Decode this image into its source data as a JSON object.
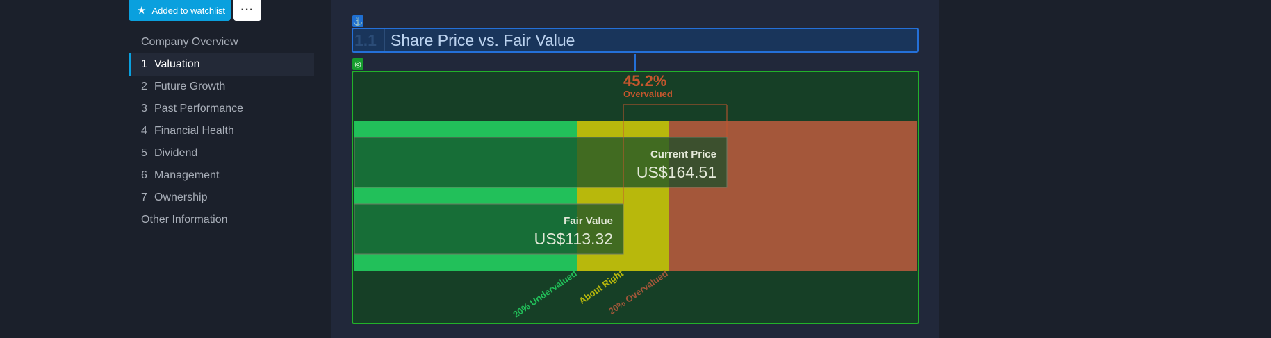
{
  "toolbar": {
    "watchlist_label": "Added to watchlist",
    "more_label": "···",
    "watch_icon": "star-icon",
    "accent": "#0aa0de"
  },
  "sidebar": {
    "items": [
      {
        "num": "",
        "label": "Company Overview"
      },
      {
        "num": "1",
        "label": "Valuation",
        "active": true
      },
      {
        "num": "2",
        "label": "Future Growth"
      },
      {
        "num": "3",
        "label": "Past Performance"
      },
      {
        "num": "4",
        "label": "Financial Health"
      },
      {
        "num": "5",
        "label": "Dividend"
      },
      {
        "num": "6",
        "label": "Management"
      },
      {
        "num": "7",
        "label": "Ownership"
      },
      {
        "num": "",
        "label": "Other Information"
      }
    ]
  },
  "section": {
    "number": "1.1",
    "title": "Share Price vs. Fair Value",
    "anchor_icon": "anchor-icon",
    "target_icon": "target-icon"
  },
  "chart_data": {
    "type": "bar",
    "current_price": {
      "label": "Current Price",
      "display": "US$164.51",
      "value": 164.51
    },
    "fair_value": {
      "label": "Fair Value",
      "display": "US$113.32",
      "value": 113.32
    },
    "valuation": {
      "percent": "45.2%",
      "status": "Overvalued"
    },
    "zones": [
      {
        "label": "20% Undervalued",
        "color": "#22c05a"
      },
      {
        "label": "About Right",
        "color": "#b8b80c"
      },
      {
        "label": "20% Overvalued",
        "color": "#a4573a"
      }
    ],
    "colors": {
      "undervalued": "#22c05a",
      "about_right": "#b8b80c",
      "overvalued": "#a4573a",
      "percent_text": "#c5562d",
      "box": "#1d7a3f"
    }
  }
}
